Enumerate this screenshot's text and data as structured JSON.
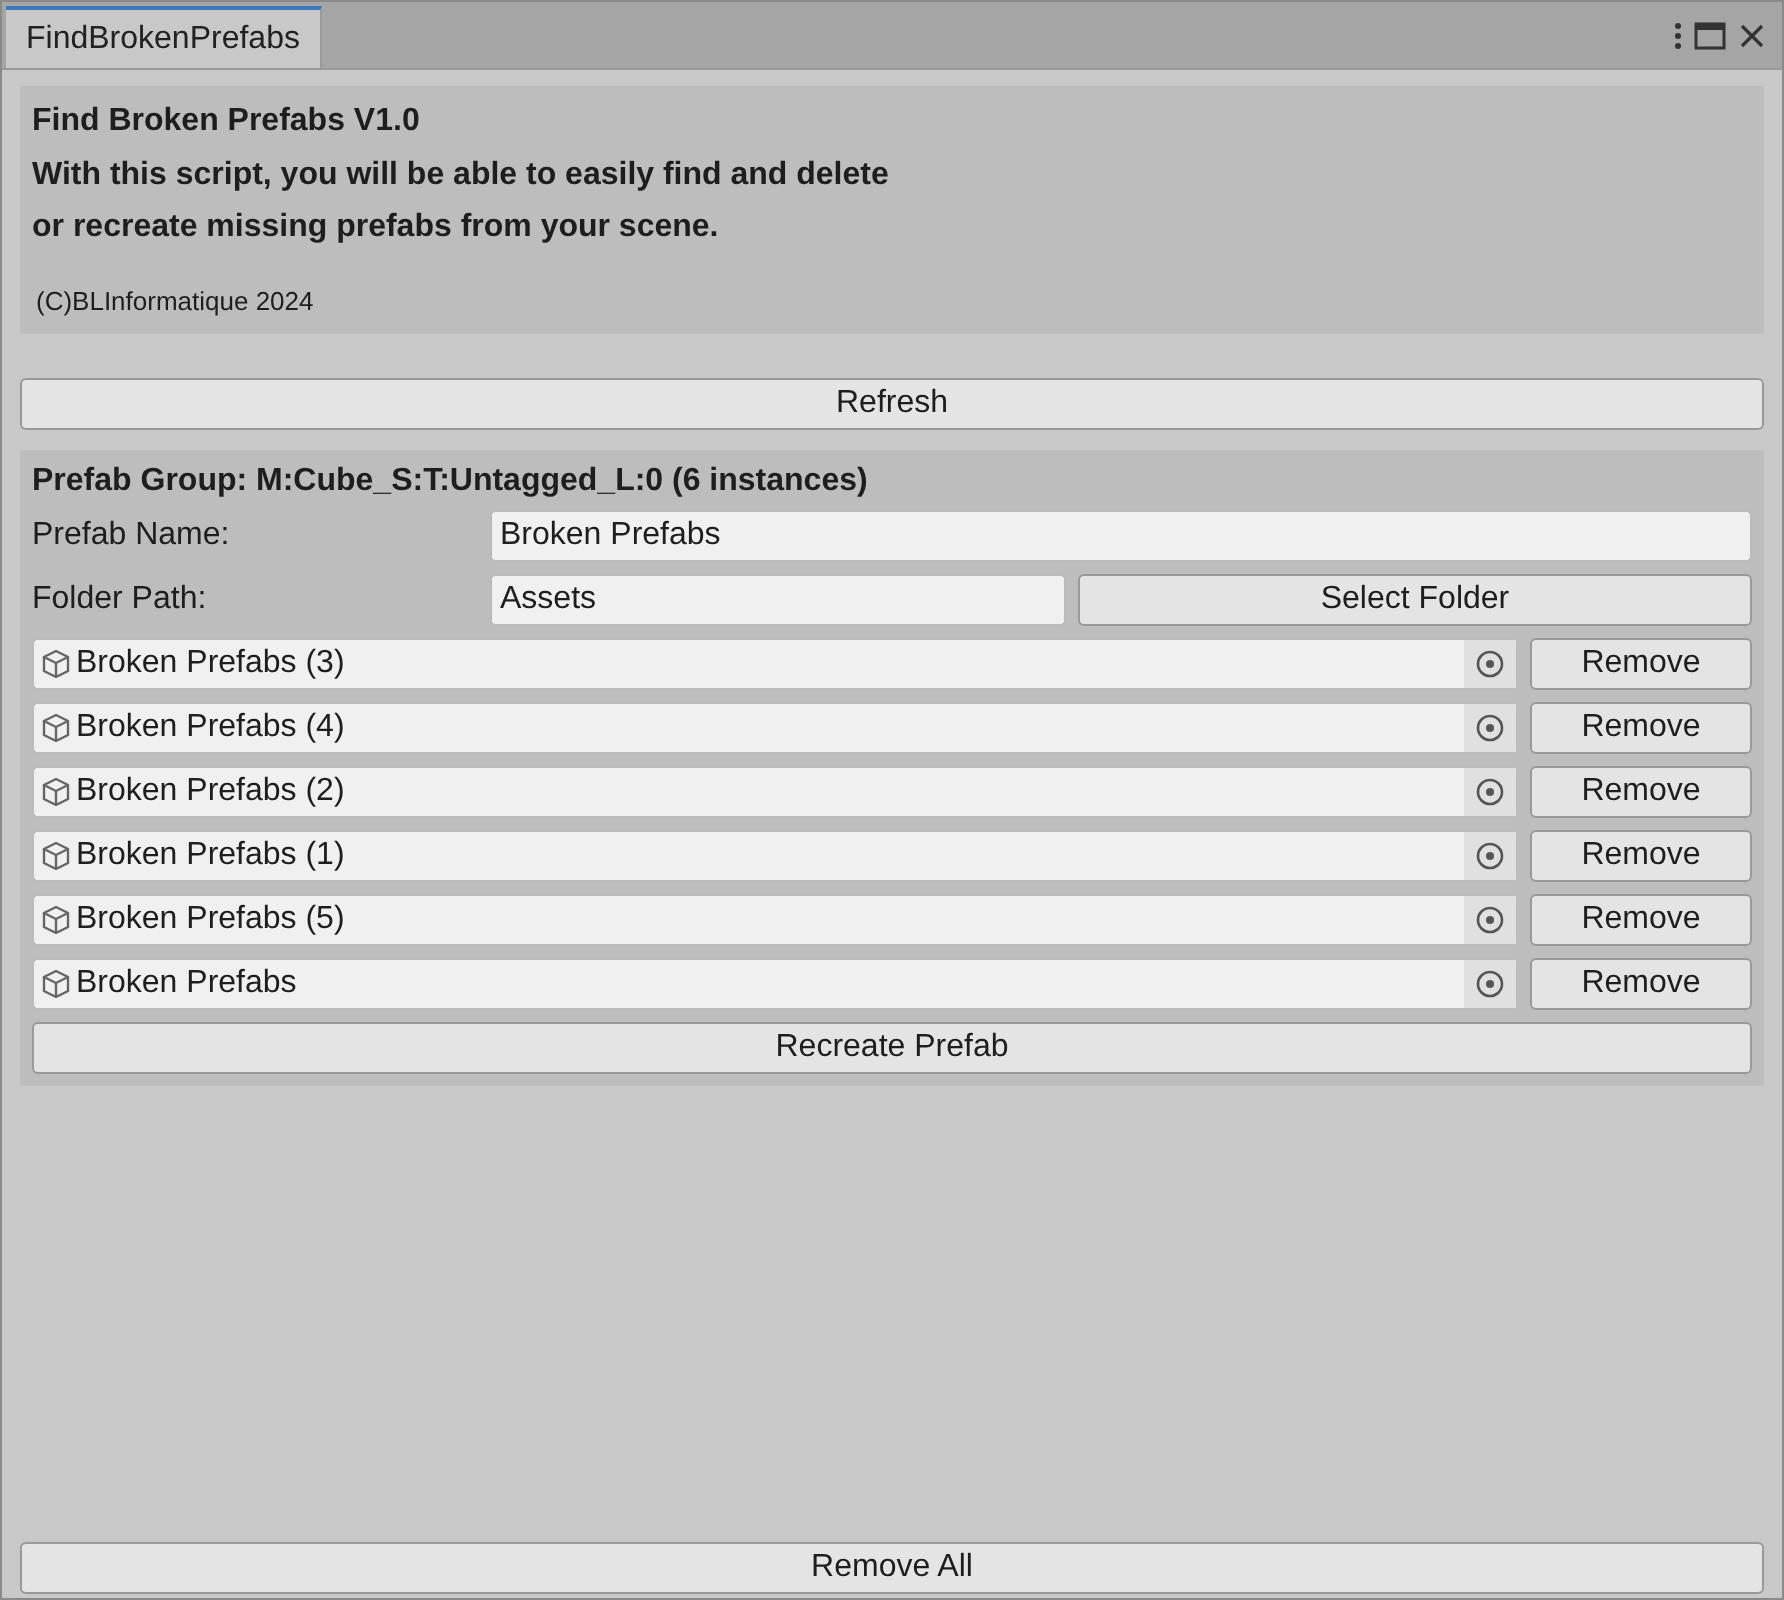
{
  "window": {
    "tab": "FindBrokenPrefabs"
  },
  "header": {
    "title": "Find Broken Prefabs V1.0",
    "description": "With this script, you will be able to easily find and delete\nor recreate missing prefabs from your scene.",
    "copyright": "(C)BLInformatique 2024"
  },
  "refresh_button": "Refresh",
  "group": {
    "title": "Prefab Group: M:Cube_S:T:Untagged_L:0 (6 instances)",
    "name_label": "Prefab Name:",
    "name_value": "Broken Prefabs",
    "folder_label": "Folder Path:",
    "folder_value": "Assets",
    "select_folder_button": "Select Folder",
    "instances": [
      {
        "name": "Broken Prefabs (3)",
        "button": "Remove"
      },
      {
        "name": "Broken Prefabs (4)",
        "button": "Remove"
      },
      {
        "name": "Broken Prefabs (2)",
        "button": "Remove"
      },
      {
        "name": "Broken Prefabs (1)",
        "button": "Remove"
      },
      {
        "name": "Broken Prefabs (5)",
        "button": "Remove"
      },
      {
        "name": "Broken Prefabs",
        "button": "Remove"
      }
    ],
    "recreate_button": "Recreate Prefab"
  },
  "remove_all_button": "Remove All"
}
